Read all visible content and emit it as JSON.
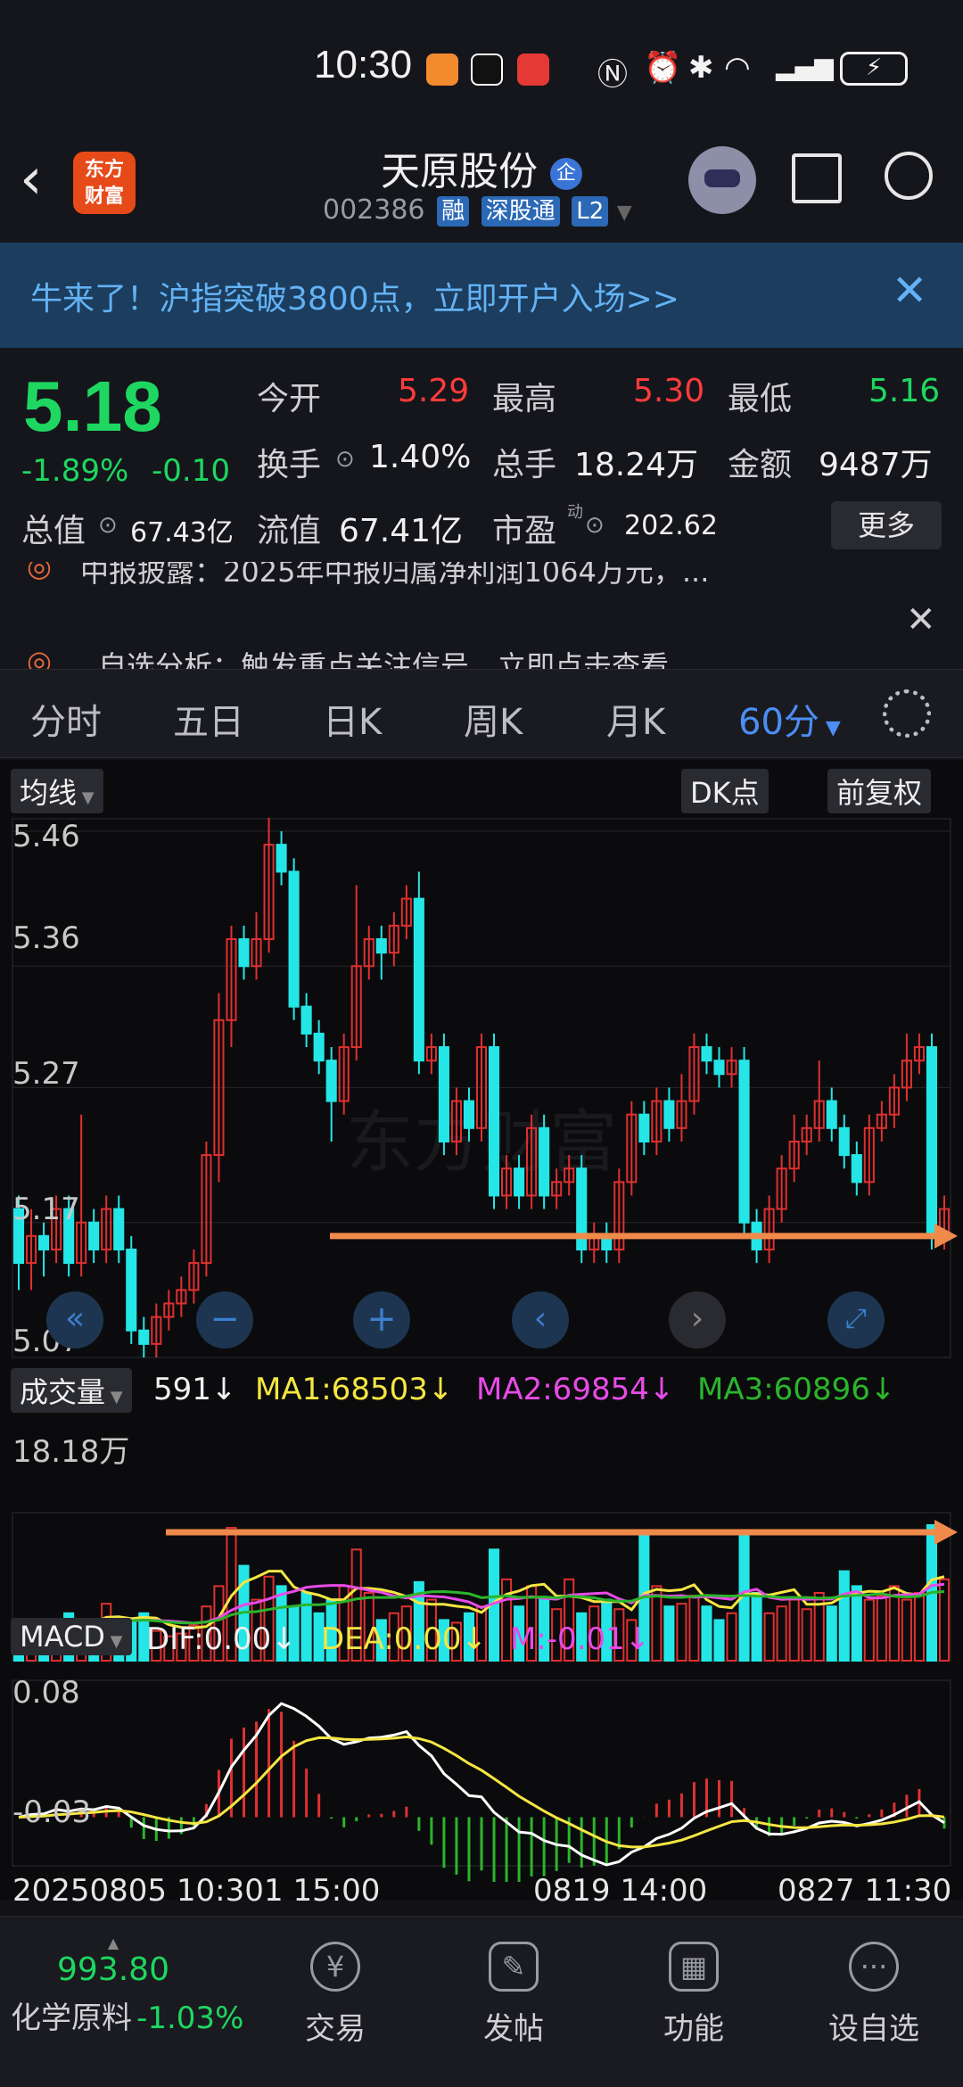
{
  "status": {
    "time": "10:30"
  },
  "header": {
    "title": "天原股份",
    "badge": "企",
    "code": "002386",
    "tag1": "融",
    "tag2": "深股通",
    "tag3": "L2",
    "logo_line1": "东方",
    "logo_line2": "财富"
  },
  "banner": {
    "text": "牛来了！沪指突破3800点，立即开户入场>>"
  },
  "quote": {
    "price": "5.18",
    "change_pct": "-1.89%",
    "change": "-0.10",
    "open_label": "今开",
    "open": "5.29",
    "high_label": "最高",
    "high": "5.30",
    "low_label": "最低",
    "low": "5.16",
    "turnover_label": "换手",
    "turnover": "1.40%",
    "volume_label": "总手",
    "volume": "18.24万",
    "amount_label": "金额",
    "amount": "9487万",
    "mktcap_label": "总值",
    "mktcap": "67.43亿",
    "float_label": "流值",
    "float": "67.41亿",
    "pe_label": "市盈",
    "pe_sup": "动",
    "pe": "202.62",
    "more": "更多"
  },
  "news": {
    "item1": "中报披露：2025年中报归属净利润1064万元，...",
    "item2": "自选分析：触发重点关注信号，立即点击查看"
  },
  "tabs": [
    "分时",
    "五日",
    "日K",
    "周K",
    "月K",
    "60分"
  ],
  "active_tab": "60分",
  "chart": {
    "ma_label": "均线",
    "dk_label": "DK点",
    "adj_label": "前复权",
    "y_labels": [
      "5.46",
      "5.36",
      "5.27",
      "5.17",
      "5.07"
    ],
    "vol_label": "成交量",
    "vol_value": "591",
    "ma1": "MA1:68503",
    "ma2": "MA2:69854",
    "ma3": "MA3:60896",
    "vol_max": "18.18万",
    "macd_label": "MACD",
    "dif": "DIF:0.00",
    "dea": "DEA:0.00",
    "m": "M:-0.01",
    "macd_top": "0.08",
    "macd_bottom": "-0.03",
    "x_labels": [
      "20250805 10:30",
      "1 15:00",
      "0819 14:00",
      "0827 11:30"
    ],
    "watermark": "东方财富",
    "colors": {
      "up": "#e03030",
      "down": "#25e6e6",
      "ma1": "#f5e642",
      "ma2": "#e84be8",
      "ma3": "#2bb52b",
      "arrow": "#f08a4b"
    }
  },
  "chart_data": {
    "type": "candlestick",
    "y_range": [
      5.07,
      5.46
    ],
    "candles": [
      [
        5.18,
        5.14,
        5.19,
        5.12
      ],
      [
        5.14,
        5.16,
        5.18,
        5.12
      ],
      [
        5.16,
        5.15,
        5.17,
        5.13
      ],
      [
        5.15,
        5.18,
        5.19,
        5.14
      ],
      [
        5.18,
        5.14,
        5.19,
        5.13
      ],
      [
        5.14,
        5.17,
        5.25,
        5.13
      ],
      [
        5.17,
        5.15,
        5.18,
        5.14
      ],
      [
        5.15,
        5.18,
        5.19,
        5.14
      ],
      [
        5.18,
        5.15,
        5.19,
        5.14
      ],
      [
        5.15,
        5.09,
        5.16,
        5.08
      ],
      [
        5.09,
        5.08,
        5.1,
        5.07
      ],
      [
        5.08,
        5.1,
        5.11,
        5.07
      ],
      [
        5.1,
        5.11,
        5.12,
        5.09
      ],
      [
        5.11,
        5.12,
        5.13,
        5.1
      ],
      [
        5.12,
        5.14,
        5.15,
        5.11
      ],
      [
        5.14,
        5.22,
        5.23,
        5.13
      ],
      [
        5.22,
        5.32,
        5.34,
        5.2
      ],
      [
        5.32,
        5.38,
        5.39,
        5.3
      ],
      [
        5.38,
        5.36,
        5.39,
        5.35
      ],
      [
        5.36,
        5.38,
        5.4,
        5.35
      ],
      [
        5.38,
        5.45,
        5.47,
        5.37
      ],
      [
        5.45,
        5.43,
        5.46,
        5.42
      ],
      [
        5.43,
        5.33,
        5.44,
        5.32
      ],
      [
        5.33,
        5.31,
        5.34,
        5.3
      ],
      [
        5.31,
        5.29,
        5.32,
        5.28
      ],
      [
        5.29,
        5.26,
        5.3,
        5.23
      ],
      [
        5.26,
        5.3,
        5.31,
        5.25
      ],
      [
        5.3,
        5.36,
        5.42,
        5.29
      ],
      [
        5.36,
        5.38,
        5.39,
        5.35
      ],
      [
        5.38,
        5.37,
        5.39,
        5.35
      ],
      [
        5.37,
        5.39,
        5.4,
        5.36
      ],
      [
        5.39,
        5.41,
        5.42,
        5.38
      ],
      [
        5.41,
        5.29,
        5.43,
        5.28
      ],
      [
        5.29,
        5.3,
        5.31,
        5.28
      ],
      [
        5.3,
        5.23,
        5.31,
        5.22
      ],
      [
        5.23,
        5.26,
        5.27,
        5.22
      ],
      [
        5.26,
        5.24,
        5.27,
        5.23
      ],
      [
        5.24,
        5.3,
        5.31,
        5.23
      ],
      [
        5.3,
        5.19,
        5.31,
        5.18
      ],
      [
        5.19,
        5.21,
        5.22,
        5.18
      ],
      [
        5.21,
        5.19,
        5.22,
        5.18
      ],
      [
        5.19,
        5.24,
        5.25,
        5.18
      ],
      [
        5.24,
        5.19,
        5.25,
        5.18
      ],
      [
        5.19,
        5.2,
        5.21,
        5.18
      ],
      [
        5.2,
        5.21,
        5.22,
        5.19
      ],
      [
        5.21,
        5.15,
        5.22,
        5.14
      ],
      [
        5.15,
        5.16,
        5.17,
        5.14
      ],
      [
        5.16,
        5.15,
        5.17,
        5.14
      ],
      [
        5.15,
        5.2,
        5.21,
        5.14
      ],
      [
        5.2,
        5.25,
        5.26,
        5.19
      ],
      [
        5.25,
        5.23,
        5.26,
        5.22
      ],
      [
        5.23,
        5.26,
        5.27,
        5.22
      ],
      [
        5.26,
        5.24,
        5.27,
        5.23
      ],
      [
        5.24,
        5.26,
        5.28,
        5.23
      ],
      [
        5.26,
        5.3,
        5.31,
        5.25
      ],
      [
        5.3,
        5.29,
        5.31,
        5.28
      ],
      [
        5.29,
        5.28,
        5.3,
        5.27
      ],
      [
        5.28,
        5.29,
        5.3,
        5.27
      ],
      [
        5.29,
        5.17,
        5.3,
        5.16
      ],
      [
        5.17,
        5.15,
        5.18,
        5.14
      ],
      [
        5.15,
        5.18,
        5.19,
        5.14
      ],
      [
        5.18,
        5.21,
        5.22,
        5.17
      ],
      [
        5.21,
        5.23,
        5.25,
        5.2
      ],
      [
        5.23,
        5.24,
        5.25,
        5.22
      ],
      [
        5.24,
        5.26,
        5.29,
        5.23
      ],
      [
        5.26,
        5.24,
        5.27,
        5.23
      ],
      [
        5.24,
        5.22,
        5.25,
        5.21
      ],
      [
        5.22,
        5.2,
        5.23,
        5.19
      ],
      [
        5.2,
        5.24,
        5.25,
        5.19
      ],
      [
        5.24,
        5.25,
        5.26,
        5.23
      ],
      [
        5.25,
        5.27,
        5.28,
        5.24
      ],
      [
        5.27,
        5.29,
        5.31,
        5.26
      ],
      [
        5.29,
        5.3,
        5.31,
        5.28
      ],
      [
        5.3,
        5.16,
        5.31,
        5.15
      ],
      [
        5.16,
        5.18,
        5.19,
        5.15
      ]
    ],
    "volume_max": 181800,
    "volumes": [
      0.3,
      0.25,
      0.22,
      0.28,
      0.35,
      0.3,
      0.25,
      0.42,
      0.3,
      0.28,
      0.35,
      0.22,
      0.18,
      0.2,
      0.26,
      0.4,
      0.55,
      0.98,
      0.7,
      0.45,
      0.62,
      0.55,
      0.4,
      0.5,
      0.35,
      0.45,
      0.55,
      0.82,
      0.5,
      0.3,
      0.35,
      0.4,
      0.58,
      0.45,
      0.3,
      0.28,
      0.35,
      0.4,
      0.82,
      0.6,
      0.4,
      0.55,
      0.45,
      0.38,
      0.6,
      0.35,
      0.4,
      0.45,
      0.38,
      0.3,
      0.95,
      0.55,
      0.4,
      0.42,
      0.48,
      0.4,
      0.3,
      0.35,
      0.92,
      0.5,
      0.35,
      0.4,
      0.45,
      0.38,
      0.5,
      0.4,
      0.66,
      0.55,
      0.45,
      0.48,
      0.55,
      0.45,
      0.5,
      1.0,
      0.6
    ],
    "macd_range": [
      -0.03,
      0.08
    ]
  }
}
